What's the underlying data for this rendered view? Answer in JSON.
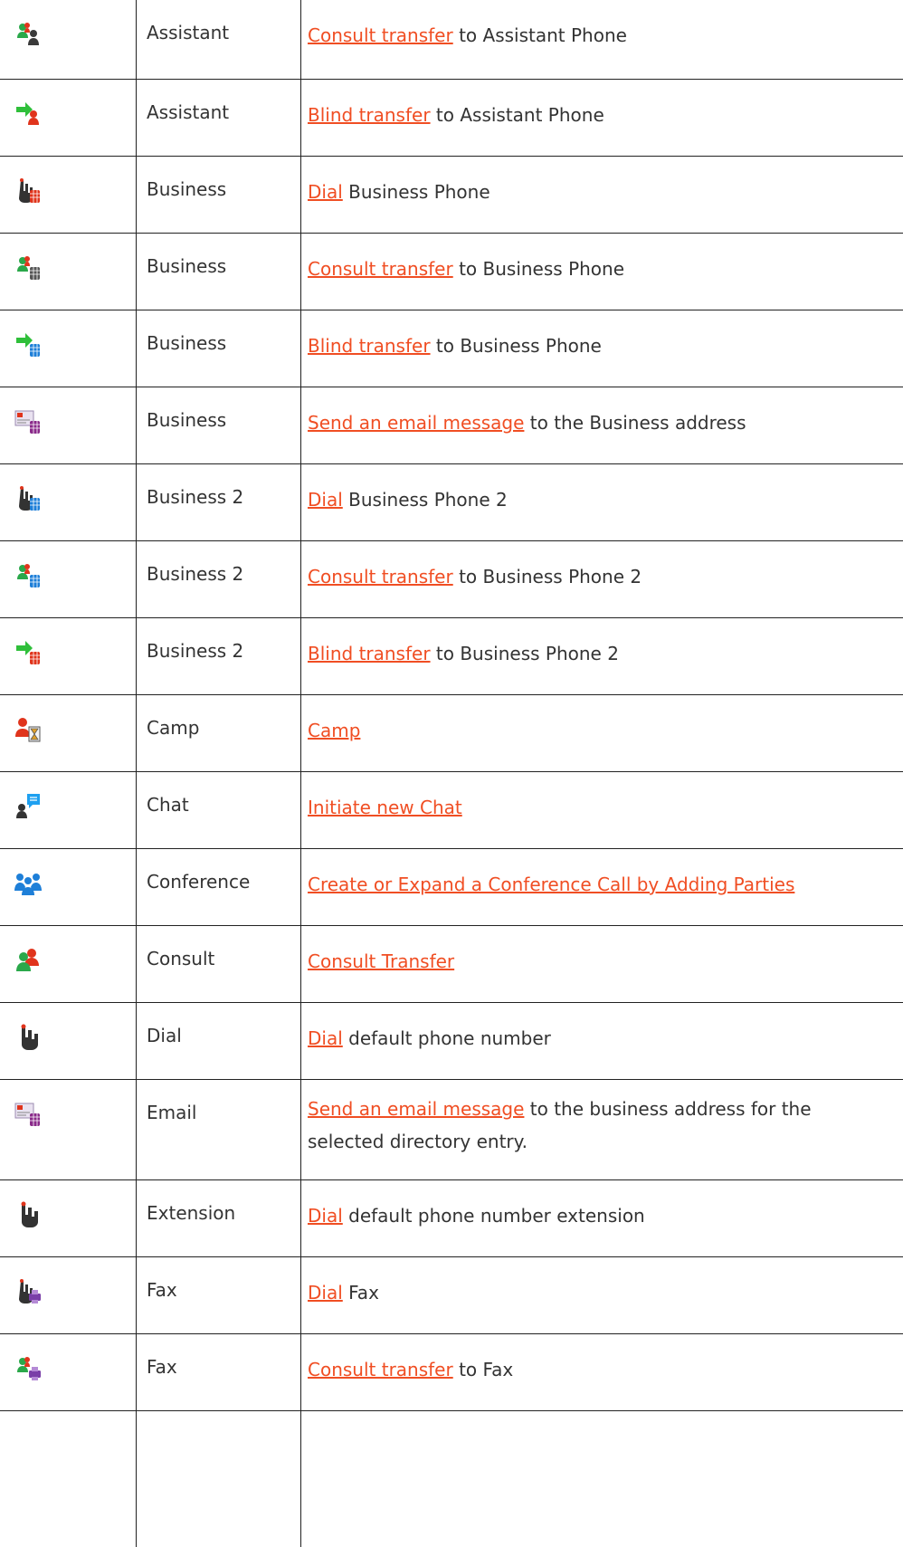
{
  "rows": [
    {
      "icon": "consult-transfer-assistant-icon",
      "type": "Assistant",
      "link": "Consult transfer",
      "rest": " to Assistant Phone"
    },
    {
      "icon": "blind-transfer-assistant-icon",
      "type": "Assistant",
      "link": "Blind transfer",
      "rest": " to Assistant Phone"
    },
    {
      "icon": "dial-business-icon",
      "type": "Business",
      "link": "Dial",
      "rest": " Business Phone"
    },
    {
      "icon": "consult-transfer-business-icon",
      "type": "Business",
      "link": "Consult transfer",
      "rest": " to Business Phone"
    },
    {
      "icon": "blind-transfer-business-icon",
      "type": "Business",
      "link": "Blind transfer",
      "rest": " to Business Phone"
    },
    {
      "icon": "email-business-icon",
      "type": "Business",
      "link": "Send an email message",
      "rest": " to the Business address"
    },
    {
      "icon": "dial-business-2-icon",
      "type": "Business 2",
      "link": "Dial",
      "rest": " Business Phone 2"
    },
    {
      "icon": "consult-transfer-business-2-icon",
      "type": "Business 2",
      "link": "Consult transfer",
      "rest": " to Business Phone 2"
    },
    {
      "icon": "blind-transfer-business-2-icon",
      "type": "Business 2",
      "link": "Blind transfer",
      "rest": " to Business Phone 2"
    },
    {
      "icon": "camp-icon",
      "type": "Camp",
      "link": "Camp",
      "rest": ""
    },
    {
      "icon": "chat-icon",
      "type": "Chat",
      "link": "Initiate new Chat",
      "rest": ""
    },
    {
      "icon": "conference-icon",
      "type": "Conference",
      "link": "Create or Expand a Conference Call by Adding Parties",
      "rest": ""
    },
    {
      "icon": "consult-icon",
      "type": "Consult",
      "link": "Consult Transfer",
      "rest": ""
    },
    {
      "icon": "dial-icon",
      "type": "Dial",
      "link": "Dial",
      "rest": " default phone number"
    },
    {
      "icon": "email-icon",
      "type": "Email",
      "link": "Send an email message",
      "rest": " to the business address for the selected directory entry."
    },
    {
      "icon": "dial-extension-icon",
      "type": "Extension",
      "link": "Dial",
      "rest": " default phone number extension"
    },
    {
      "icon": "dial-fax-icon",
      "type": "Fax",
      "link": "Dial",
      "rest": " Fax"
    },
    {
      "icon": "consult-transfer-fax-icon",
      "type": "Fax",
      "link": "Consult transfer",
      "rest": " to Fax"
    }
  ]
}
